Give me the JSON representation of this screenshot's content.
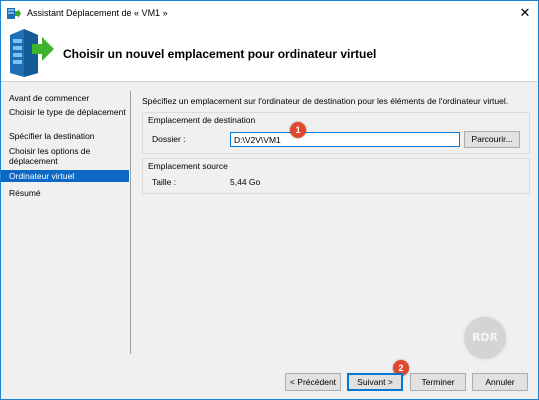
{
  "window": {
    "title": "Assistant Déplacement de « VM1 »",
    "close_glyph": "✕"
  },
  "header": {
    "title": "Choisir un nouvel emplacement pour ordinateur virtuel"
  },
  "nav": {
    "items": [
      {
        "label": "Avant de commencer",
        "active": false
      },
      {
        "label": "Choisir le type de déplacement",
        "active": false
      },
      {
        "label": "Spécifier la destination",
        "active": false
      },
      {
        "label": "Choisir les options de déplacement",
        "active": false
      },
      {
        "label": "Ordinateur virtuel",
        "active": true
      },
      {
        "label": "Résumé",
        "active": false
      }
    ]
  },
  "main": {
    "intro": "Spécifiez un emplacement sur l'ordinateur de destination pour les éléments de l'ordinateur virtuel.",
    "destination": {
      "group_title": "Emplacement de destination",
      "folder_label": "Dossier :",
      "folder_value": "D:\\V2V\\VM1",
      "browse_label": "Parcourir..."
    },
    "source": {
      "group_title": "Emplacement source",
      "size_label": "Taille :",
      "size_value": "5,44 Go"
    }
  },
  "annotations": {
    "badge_1": "1",
    "badge_2": "2"
  },
  "watermark": "RDR",
  "footer": {
    "previous_label": "< Précédent",
    "next_label": "Suivant >",
    "finish_label": "Terminer",
    "cancel_label": "Annuler"
  },
  "colors": {
    "accent": "#0b68c4",
    "badge": "#e0482d",
    "window_border": "#1883d7"
  }
}
